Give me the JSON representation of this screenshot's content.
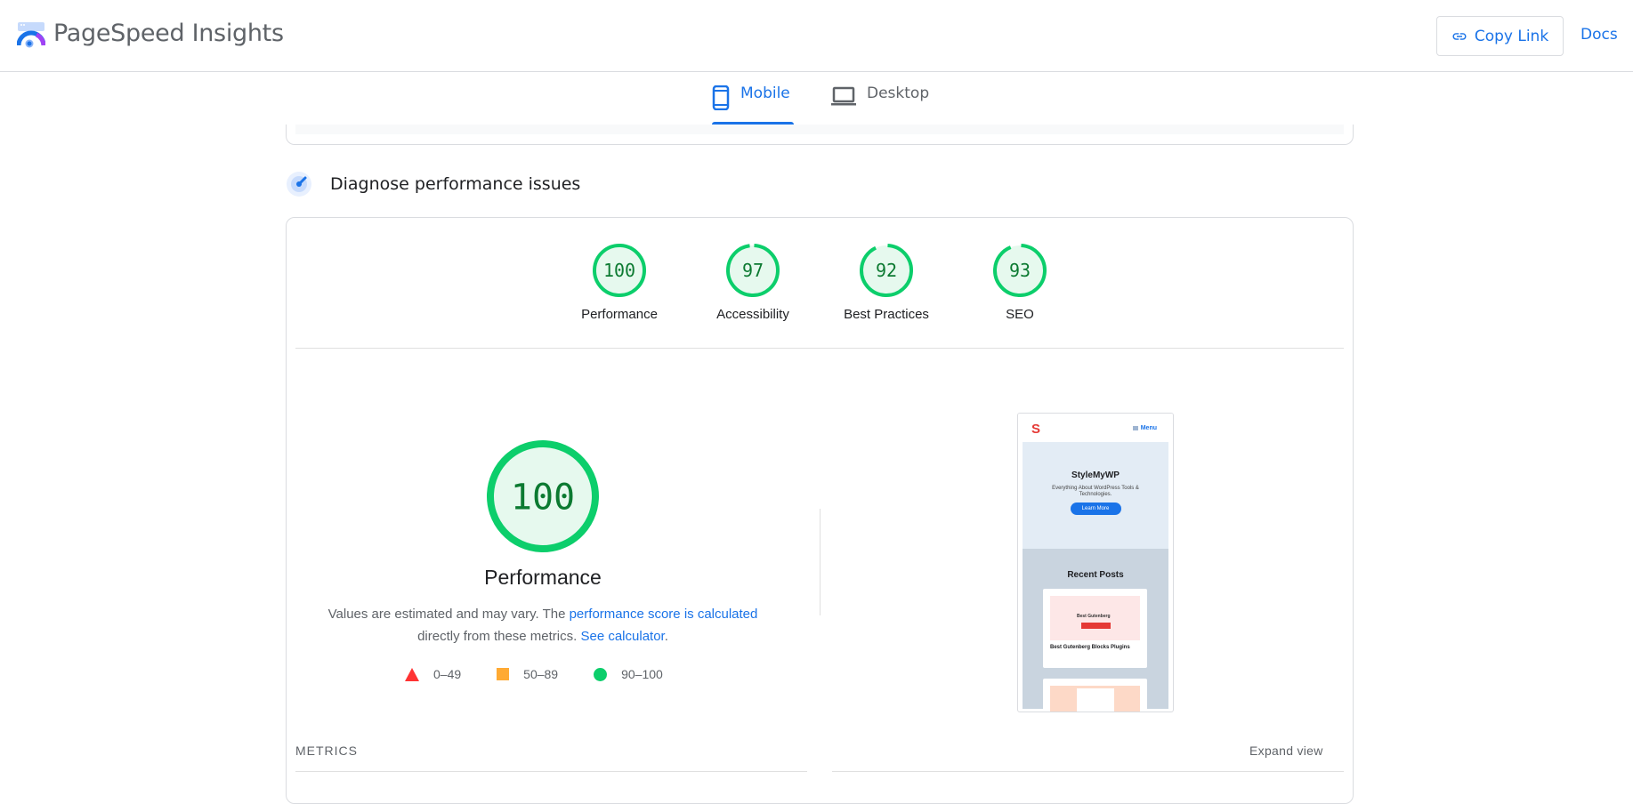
{
  "header": {
    "app_title": "PageSpeed Insights",
    "copy_link_label": "Copy Link",
    "docs_label": "Docs"
  },
  "tabs": [
    {
      "label": "Mobile",
      "icon": "smartphone-icon",
      "active": true
    },
    {
      "label": "Desktop",
      "icon": "laptop-icon",
      "active": false
    }
  ],
  "section": {
    "title": "Diagnose performance issues",
    "icon": "radar-icon"
  },
  "scores": [
    {
      "label": "Performance",
      "value": "100",
      "fraction": 1.0
    },
    {
      "label": "Accessibility",
      "value": "97",
      "fraction": 0.97
    },
    {
      "label": "Best Practices",
      "value": "92",
      "fraction": 0.92
    },
    {
      "label": "SEO",
      "value": "93",
      "fraction": 0.93
    }
  ],
  "main_score": {
    "label": "Performance",
    "value": "100",
    "fraction": 1.0,
    "description_prefix": "Values are estimated and may vary. The ",
    "description_link1": "performance score is calculated",
    "description_middle": " directly from these metrics. ",
    "description_link2": "See calculator",
    "description_suffix": "."
  },
  "legend": [
    {
      "shape": "triangle",
      "range": "0–49",
      "color": "#ff3333"
    },
    {
      "shape": "square",
      "range": "50–89",
      "color": "#ffaa33"
    },
    {
      "shape": "circle",
      "range": "90–100",
      "color": "#0cce6b"
    }
  ],
  "screenshot": {
    "logo_letter": "S",
    "menu_label": "Menu",
    "hero_title": "StyleMyWP",
    "hero_subtitle": "Everything About WordPress Tools & Technologies.",
    "hero_button": "Learn More",
    "recent_title": "Recent Posts",
    "post_image_text": "Best Gutenberg",
    "post_title": "Best Gutenberg Blocks Plugins"
  },
  "metrics": {
    "label": "METRICS",
    "expand_label": "Expand view"
  },
  "colors": {
    "accent": "#1a73e8",
    "pass": "#0cce6b",
    "pass_text": "#0c7a31",
    "pass_fill": "#e6f9ee"
  }
}
